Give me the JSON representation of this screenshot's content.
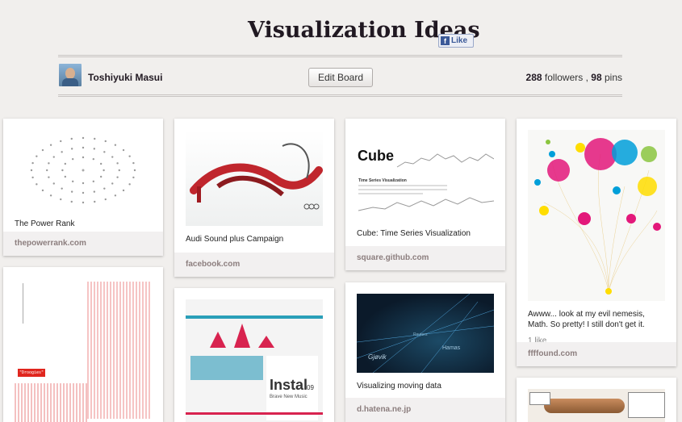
{
  "board": {
    "title": "Visualization Ideas",
    "fb_like_label": "Like",
    "owner_name": "Toshiyuki Masui",
    "edit_label": "Edit Board",
    "followers_count": "288",
    "followers_label": "followers ,",
    "pins_count": "98",
    "pins_label": "pins"
  },
  "pins": [
    {
      "description": "The Power Rank",
      "source": "thepowerrank.com"
    },
    {
      "description": "Audi Sound plus Campaign",
      "source": "facebook.com"
    },
    {
      "description": "Cube: Time Series Visualization",
      "source": "square.github.com"
    },
    {
      "description": "Awww... look at my evil nemesis, Math. So pretty! I still don't get it.",
      "likes": "1 like",
      "source": "ffffound.com"
    },
    {
      "description": "",
      "source": ""
    },
    {
      "description": "",
      "source": ""
    },
    {
      "description": "Visualizing moving data",
      "source": "d.hatena.ne.jp"
    },
    {
      "description": "",
      "source": ""
    }
  ],
  "thumb_text": {
    "cube_logo": "Cube",
    "cube_heading": "Time Series Visualization",
    "instal_title": "Instal",
    "instal_sub": "09",
    "instal_tag": "Brave New Music",
    "moving_words": [
      "Hamas",
      "Gjøvik",
      "Reuters"
    ],
    "code_button": "\"Droogies\""
  }
}
